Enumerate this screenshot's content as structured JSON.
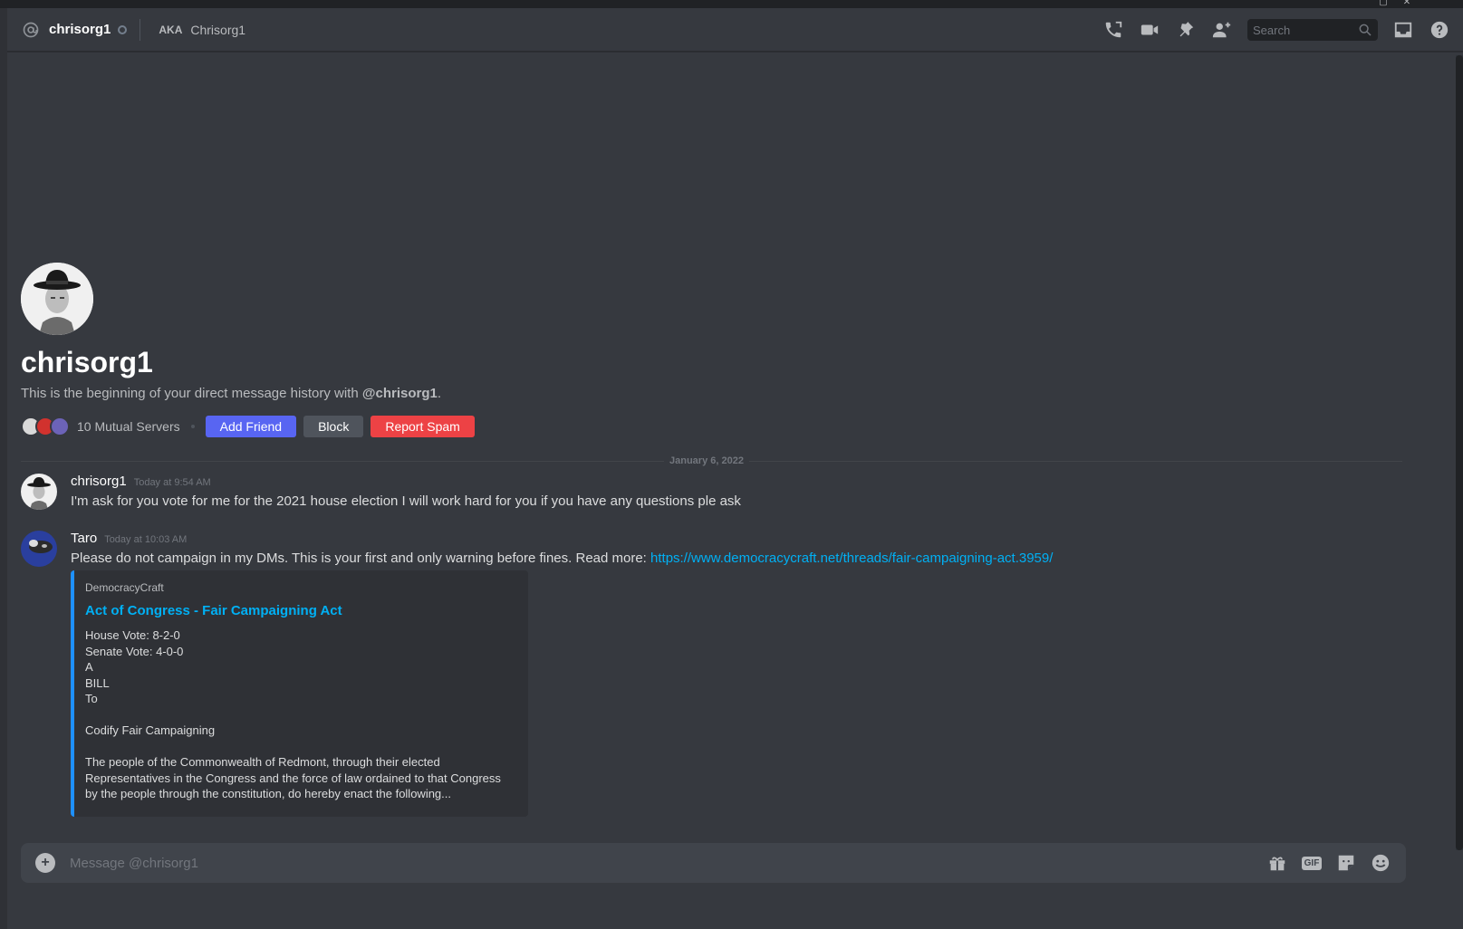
{
  "header": {
    "username": "chrisorg1",
    "aka_badge": "AKA",
    "aka_name": "Chrisorg1",
    "search_placeholder": "Search",
    "tools": [
      "phone-call-icon",
      "video-call-icon",
      "pin-icon",
      "add-member-icon"
    ],
    "right_icons": [
      "inbox-icon",
      "help-icon"
    ]
  },
  "intro": {
    "title": "chrisorg1",
    "desc_prefix": "This is the beginning of your direct message history with ",
    "desc_mention": "@chrisorg1",
    "desc_suffix": ".",
    "mutual_servers": "10 Mutual Servers",
    "add_friend": "Add Friend",
    "block": "Block",
    "report_spam": "Report Spam"
  },
  "divider": {
    "date": "January 6, 2022"
  },
  "messages": [
    {
      "author": "chrisorg1",
      "time": "Today at 9:54 AM",
      "text": "I'm ask for you vote for me for the 2021 house election I will work hard for you if you have any questions ple ask"
    },
    {
      "author": "Taro",
      "time": "Today at 10:03 AM",
      "text": "Please do not campaign in my DMs. This is your first and only warning before fines. Read more: ",
      "link": "https://www.democracycraft.net/threads/fair-campaigning-act.3959/",
      "embed": {
        "provider": "DemocracyCraft",
        "title": "Act of Congress - Fair Campaigning Act",
        "description": "House Vote: 8-2-0\nSenate Vote: 4-0-0\nA\nBILL\nTo\n\nCodify Fair Campaigning\n\nThe people of the Commonwealth of Redmont, through their elected Representatives in the Congress and the force of law ordained to that Congress by the people through the constitution, do hereby enact the following..."
      }
    }
  ],
  "composer": {
    "placeholder": "Message @chrisorg1",
    "gif_label": "GIF"
  },
  "colors": {
    "background": "#36393f",
    "blurple": "#5865f2",
    "danger": "#ed4245",
    "link": "#00b0f4"
  }
}
